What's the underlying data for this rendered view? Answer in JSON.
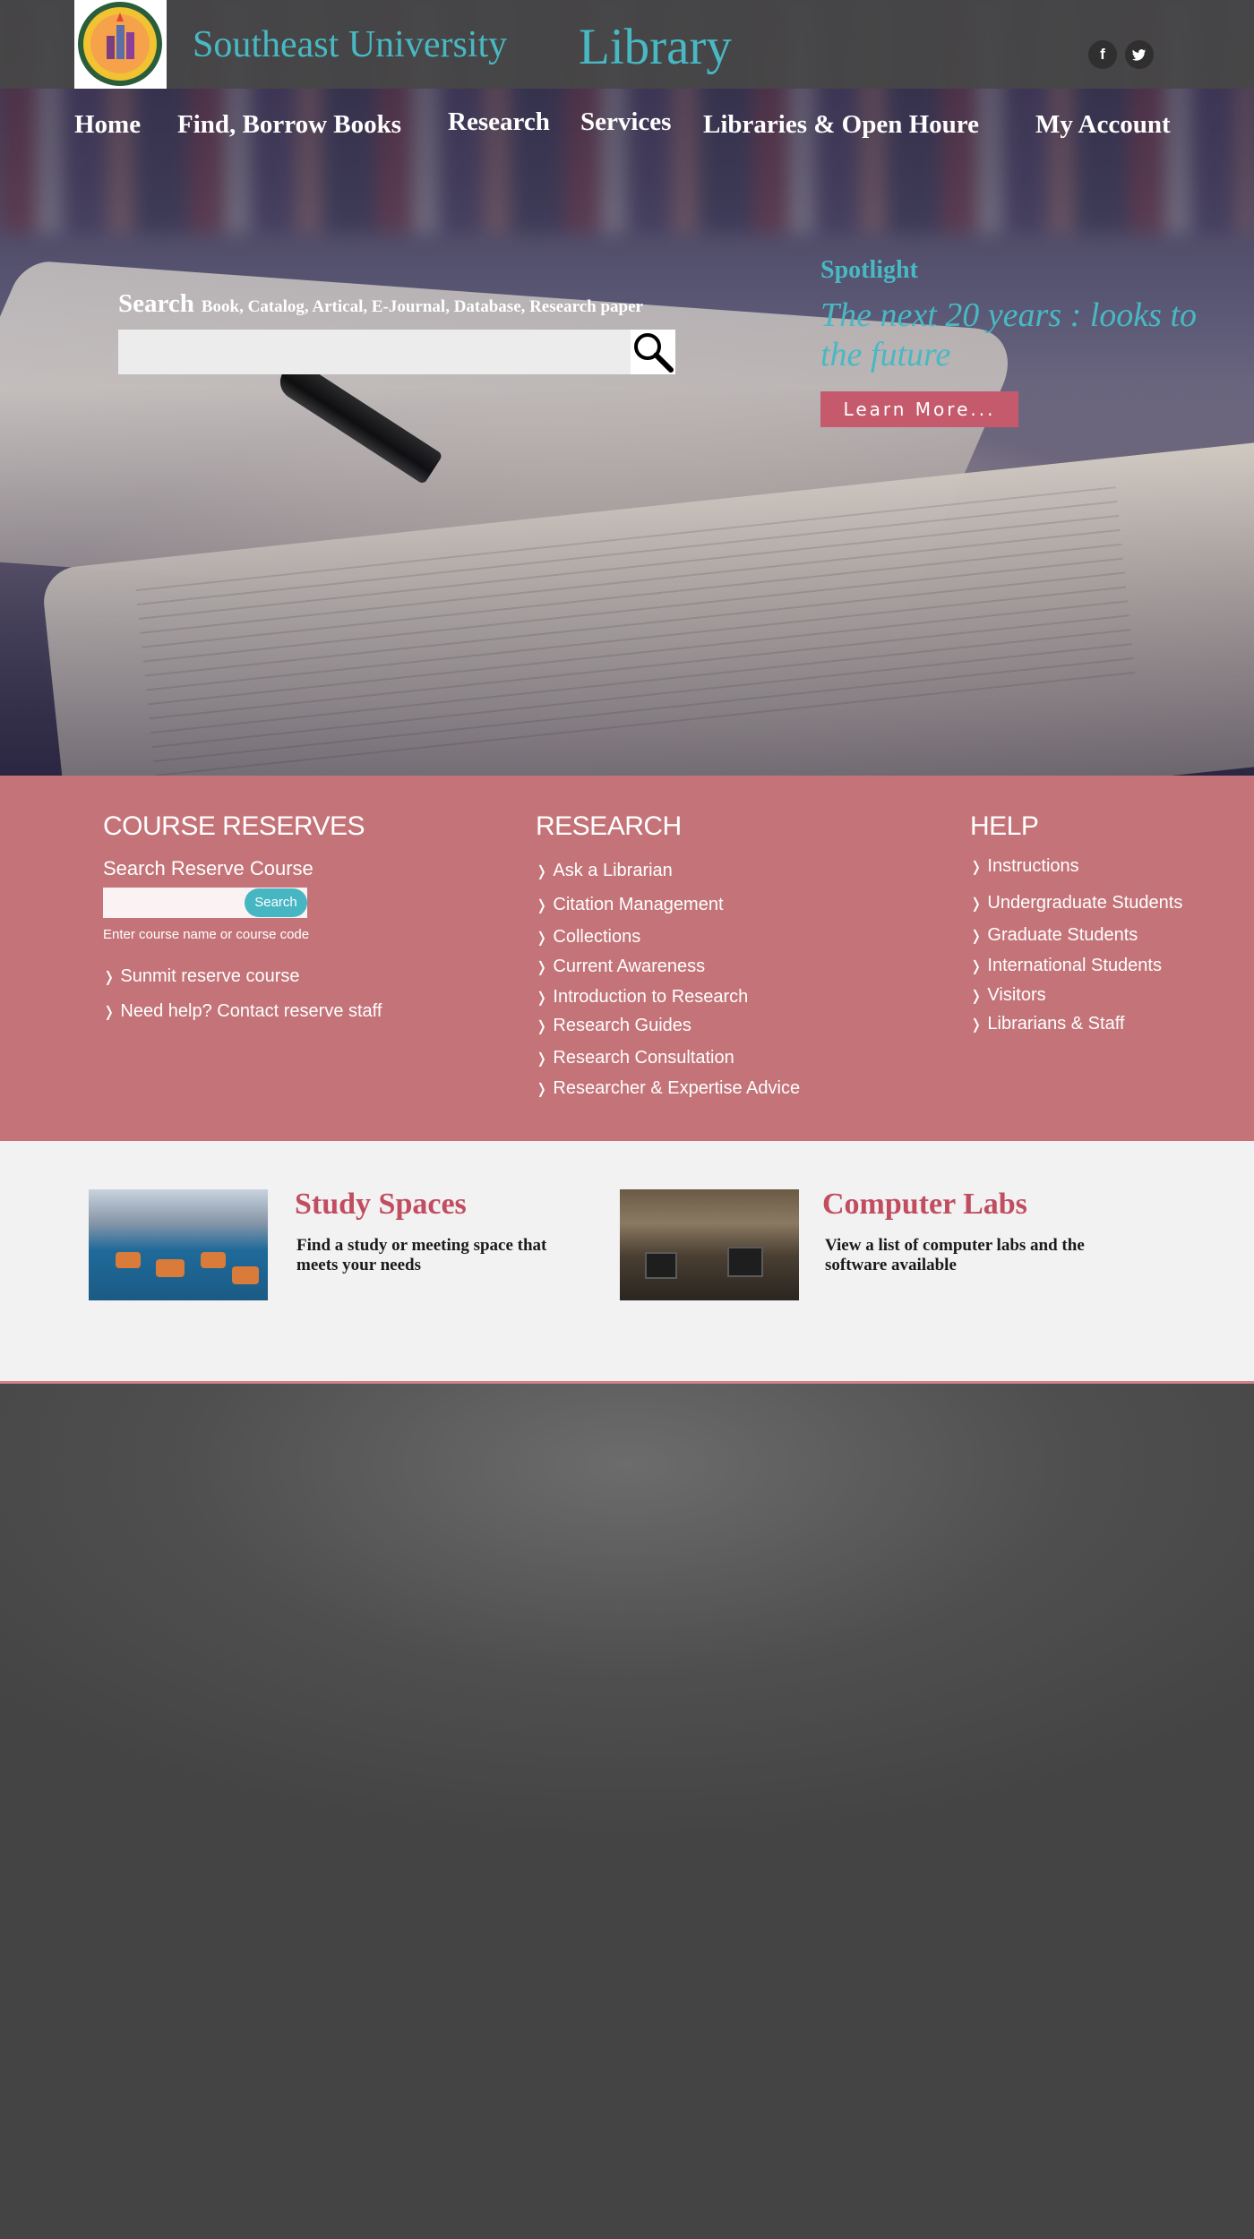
{
  "header": {
    "university": "Southeast University",
    "library": "Library",
    "social": [
      {
        "name": "facebook",
        "glyph": "f"
      },
      {
        "name": "twitter",
        "glyph": "t"
      }
    ]
  },
  "nav": {
    "items": [
      "Home",
      "Find, Borrow Books",
      "Research",
      "Services",
      "Libraries & Open Houre",
      "My Account"
    ]
  },
  "search": {
    "label": "Search",
    "scope": "Book, Catalog, Artical,  E-Journal, Database, Research paper",
    "value": "",
    "icon": "magnifier-icon"
  },
  "spotlight": {
    "label": "Spotlight",
    "title": "The next 20 years : looks to the future",
    "button": "Learn More..."
  },
  "course_reserves": {
    "heading": "COURSE RESERVES",
    "subheading": "Search Reserve Course",
    "input_value": "",
    "button": "Search",
    "hint": "Enter course name or course code",
    "links": [
      "Sunmit reserve course",
      "Need help? Contact reserve staff"
    ]
  },
  "research": {
    "heading": "RESEARCH",
    "links": [
      "Ask a Librarian",
      "Citation Management",
      "Collections",
      "Current Awareness",
      "Introduction to Research",
      "Research Guides",
      "Research Consultation",
      "Researcher & Expertise  Advice"
    ]
  },
  "help": {
    "heading": "HELP",
    "links": [
      "Instructions",
      "Undergraduate Students",
      "Graduate Students",
      "International Students",
      "Visitors",
      "Librarians & Staff"
    ]
  },
  "spaces": [
    {
      "title": "Study Spaces",
      "desc": "Find a study or meeting space that meets your needs"
    },
    {
      "title": "Computer Labs",
      "desc": "View a list of computer labs and the software available"
    }
  ],
  "colors": {
    "accent_teal": "#48b9c3",
    "band_pink": "#c47478",
    "button_pink": "#c65a6d",
    "title_red": "#c14d60"
  }
}
